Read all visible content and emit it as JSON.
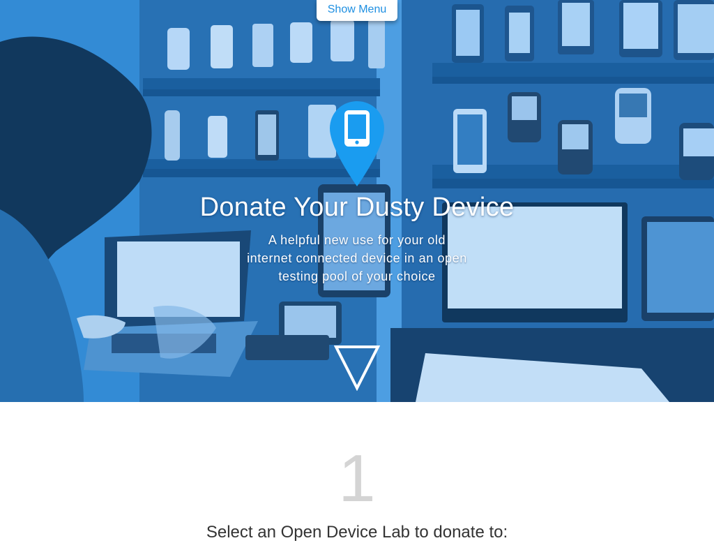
{
  "nav": {
    "menu_label": "Show Menu"
  },
  "hero": {
    "pin_icon": "mobile-device-pin-icon",
    "title": "Donate Your Dusty Device",
    "subtitle": "A helpful new use for your old internet connected device in an open testing pool of your choice",
    "scroll_icon": "triangle-down-icon"
  },
  "step": {
    "number": "1",
    "heading": "Select an Open Device Lab to donate to:"
  },
  "colors": {
    "accent": "#1e8fe1",
    "hero_tint": "#2f86d0",
    "pin": "#1a9cf0",
    "step_number": "#d4d4d4"
  }
}
